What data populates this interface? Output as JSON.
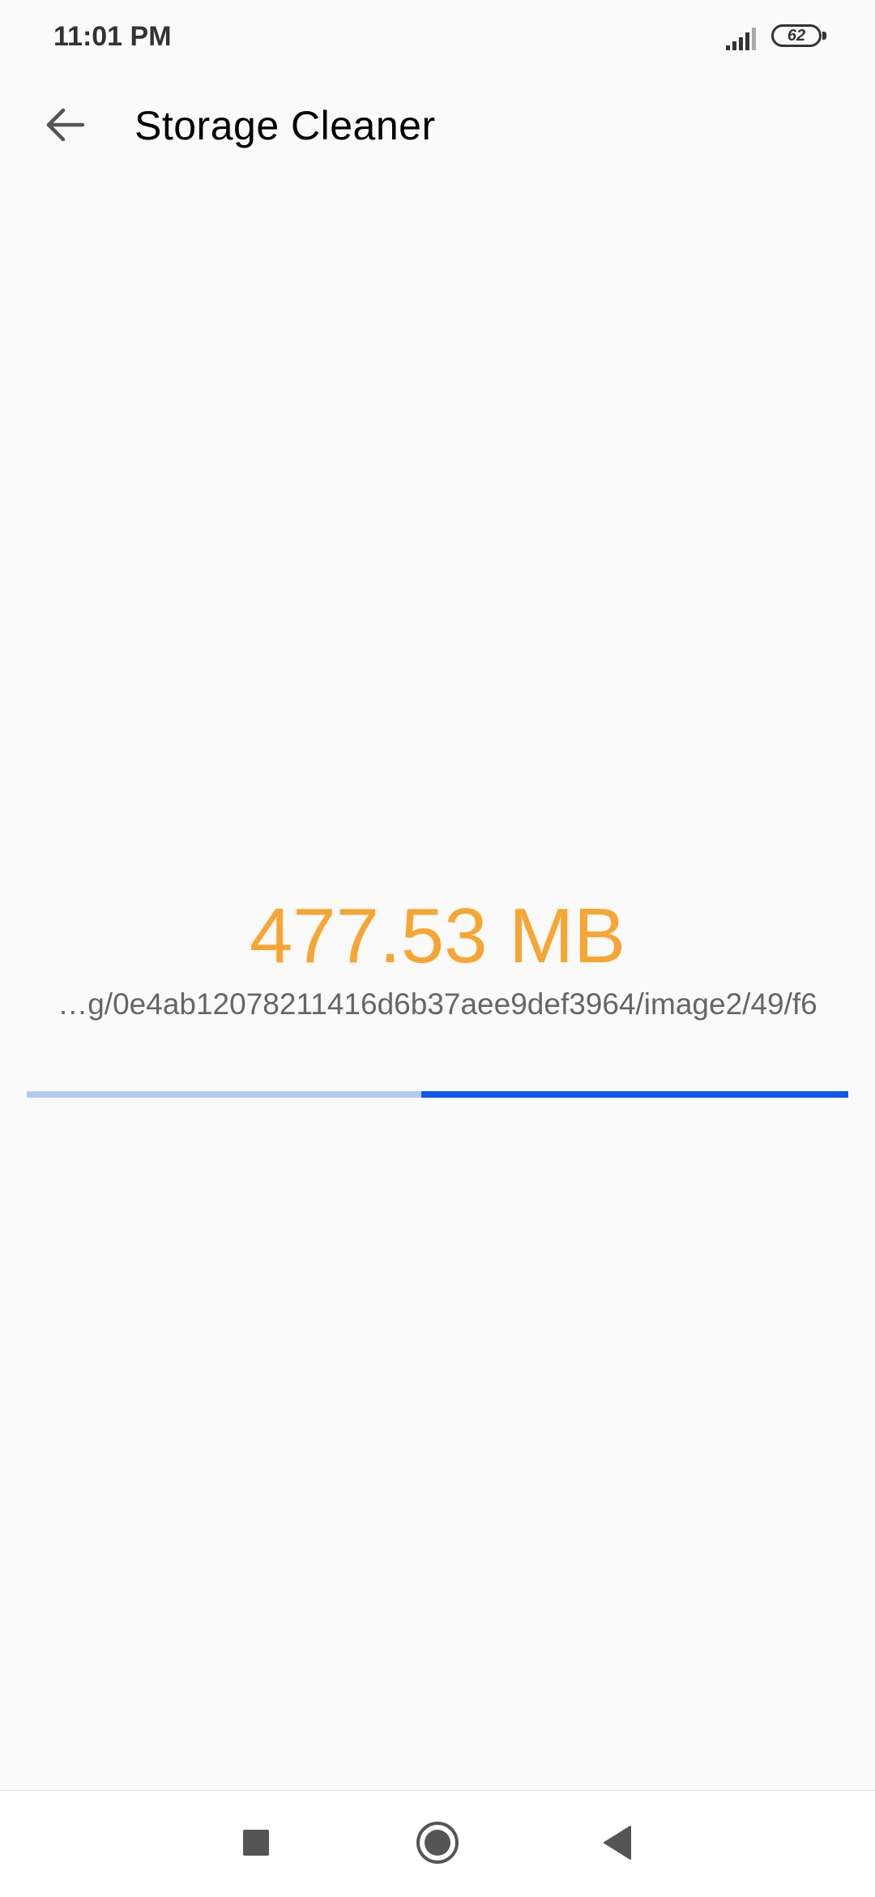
{
  "status_bar": {
    "time": "11:01 PM",
    "battery_level": "62",
    "icons": [
      "signal-icon",
      "battery-icon"
    ]
  },
  "app_bar": {
    "title": "Storage Cleaner",
    "back_icon": "arrow-left-icon"
  },
  "scan": {
    "size_found": "477.53 MB",
    "current_path": "…g/0e4ab12078211416d6b37aee9def3964/image2/49/f6",
    "progress": 0.48
  },
  "nav_bar": {
    "icons": [
      "square-recents-icon",
      "circle-home-icon",
      "triangle-back-icon"
    ]
  },
  "colors": {
    "background": "#fafafa",
    "size_text": "#f7a533",
    "path_text": "#666666",
    "progress_light": "#b3c9f5",
    "progress_dark": "#0d56f0",
    "nav_icon": "#555555"
  }
}
